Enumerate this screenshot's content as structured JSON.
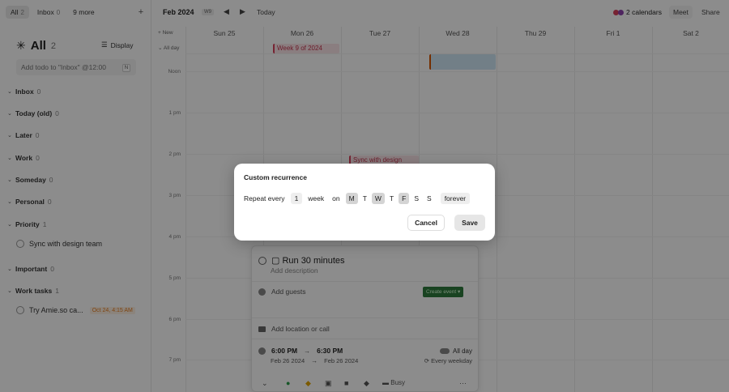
{
  "topbar": {
    "tabs": [
      {
        "label": "All",
        "count": "2"
      },
      {
        "label": "Inbox",
        "count": "0"
      },
      {
        "label": "9 more"
      }
    ]
  },
  "list": {
    "title": "All",
    "count": "2",
    "display_label": "Display",
    "add_placeholder": "Add todo to \"Inbox\" @12:00",
    "shortcut": "N"
  },
  "sections": [
    {
      "name": "Inbox",
      "count": "0"
    },
    {
      "name": "Today (old)",
      "count": "0"
    },
    {
      "name": "Later",
      "count": "0"
    },
    {
      "name": "Work",
      "count": "0"
    },
    {
      "name": "Someday",
      "count": "0"
    },
    {
      "name": "Personal",
      "count": "0"
    },
    {
      "name": "Priority",
      "count": "1"
    },
    {
      "name": "Important",
      "count": "0"
    },
    {
      "name": "Work tasks",
      "count": "1"
    }
  ],
  "tasks": [
    {
      "label": "Sync with design team"
    },
    {
      "label": "Try Amie.so ca...",
      "due": "Oct 24, 4:15 AM"
    }
  ],
  "calendar": {
    "month": "Feb 2024",
    "week_badge": "W9",
    "today_label": "Today",
    "calendars_label": "2 calendars",
    "meet_label": "Meet",
    "share_label": "Share",
    "new_label": "New",
    "allday_label": "All day",
    "days": [
      "Sun 25",
      "Mon 26",
      "Tue 27",
      "Wed 28",
      "Thu 29",
      "Fri  1",
      "Sat  2"
    ],
    "times": [
      "Noon",
      "1 pm",
      "2 pm",
      "3 pm",
      "4 pm",
      "5 pm",
      "6 pm",
      "7 pm"
    ],
    "events": {
      "week": "Week 9 of 2024",
      "sync": "Sync with design"
    },
    "colors": {
      "dot1": "#d9415c",
      "dot2": "#8e44ad"
    }
  },
  "panel": {
    "title": "Run 30 minutes",
    "description_placeholder": "Add description",
    "guests_label": "Add guests",
    "create_event": "Create event",
    "location_label": "Add location or call",
    "start_time": "6:00 PM",
    "end_time": "6:30 PM",
    "start_date": "Feb 26 2024",
    "end_date": "Feb 26 2024",
    "allday_label": "All day",
    "repeat_label": "Every weekday",
    "busy_label": "Busy"
  },
  "modal": {
    "title": "Custom recurrence",
    "repeat_every": "Repeat every",
    "interval": "1",
    "unit": "week",
    "on": "on",
    "weekdays": [
      {
        "label": "M",
        "selected": true
      },
      {
        "label": "T",
        "selected": false
      },
      {
        "label": "W",
        "selected": true
      },
      {
        "label": "T",
        "selected": false
      },
      {
        "label": "F",
        "selected": true
      },
      {
        "label": "S",
        "selected": false
      },
      {
        "label": "S",
        "selected": false
      }
    ],
    "ends": "forever",
    "cancel": "Cancel",
    "save": "Save"
  }
}
